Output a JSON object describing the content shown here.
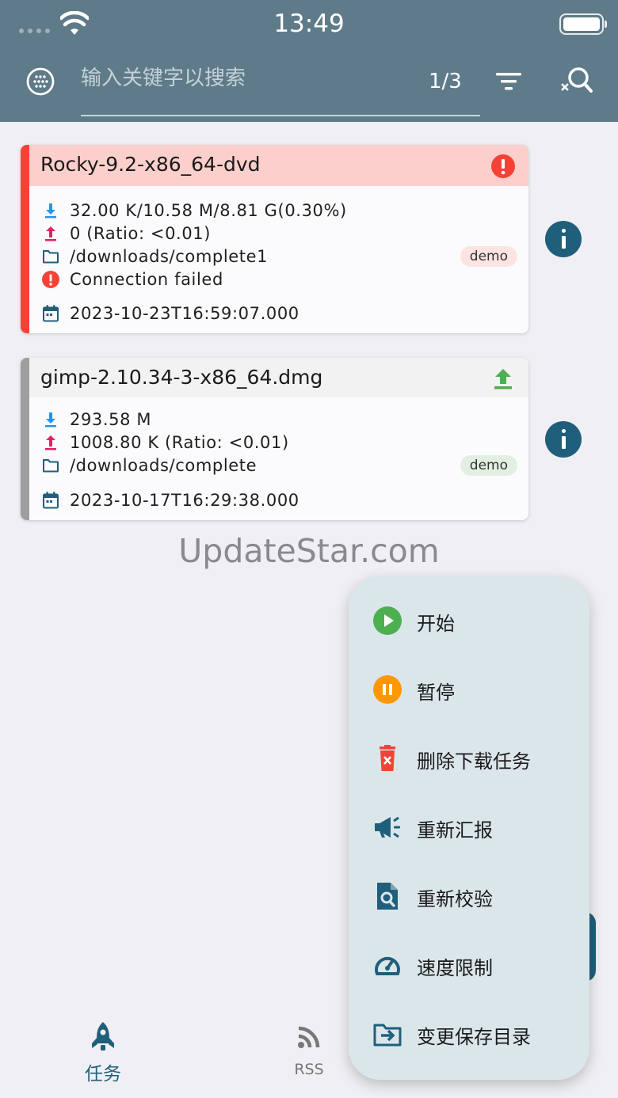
{
  "status_bar": {
    "time": "13:49"
  },
  "search": {
    "placeholder": "输入关键字以搜索",
    "page_indicator": "1/3"
  },
  "torrents": [
    {
      "name": "Rocky-9.2-x86_64-dvd",
      "download": "32.00 K/10.58 M/8.81 G(0.30%)",
      "upload": "0 (Ratio: <0.01)",
      "path": "/downloads/complete1",
      "tag": "demo",
      "error": "Connection failed",
      "date": "2023-10-23T16:59:07.000",
      "status_icon": "error-icon",
      "accent": "#f44336"
    },
    {
      "name": "gimp-2.10.34-3-x86_64.dmg",
      "download": "293.58 M",
      "upload": "1008.80 K (Ratio: <0.01)",
      "path": "/downloads/complete",
      "tag": "demo",
      "date": "2023-10-17T16:29:38.000",
      "status_icon": "upload-icon",
      "accent": "#9e9e9e"
    }
  ],
  "watermark": "UpdateStar.com",
  "menu": {
    "items": [
      {
        "label": "开始",
        "icon": "play-icon",
        "color": "#4caf50"
      },
      {
        "label": "暂停",
        "icon": "pause-icon",
        "color": "#ff9800"
      },
      {
        "label": "删除下载任务",
        "icon": "trash-icon",
        "color": "#f44336"
      },
      {
        "label": "重新汇报",
        "icon": "megaphone-icon",
        "color": "#1f5f7b"
      },
      {
        "label": "重新校验",
        "icon": "file-search-icon",
        "color": "#1f5f7b"
      },
      {
        "label": "速度限制",
        "icon": "speedometer-icon",
        "color": "#1f5f7b"
      },
      {
        "label": "变更保存目录",
        "icon": "folder-move-icon",
        "color": "#1f5f7b"
      }
    ]
  },
  "bottom_nav": {
    "tasks": {
      "label": "任务",
      "icon": "rocket-icon"
    },
    "rss": {
      "label": "RSS",
      "icon": "rss-icon"
    }
  }
}
